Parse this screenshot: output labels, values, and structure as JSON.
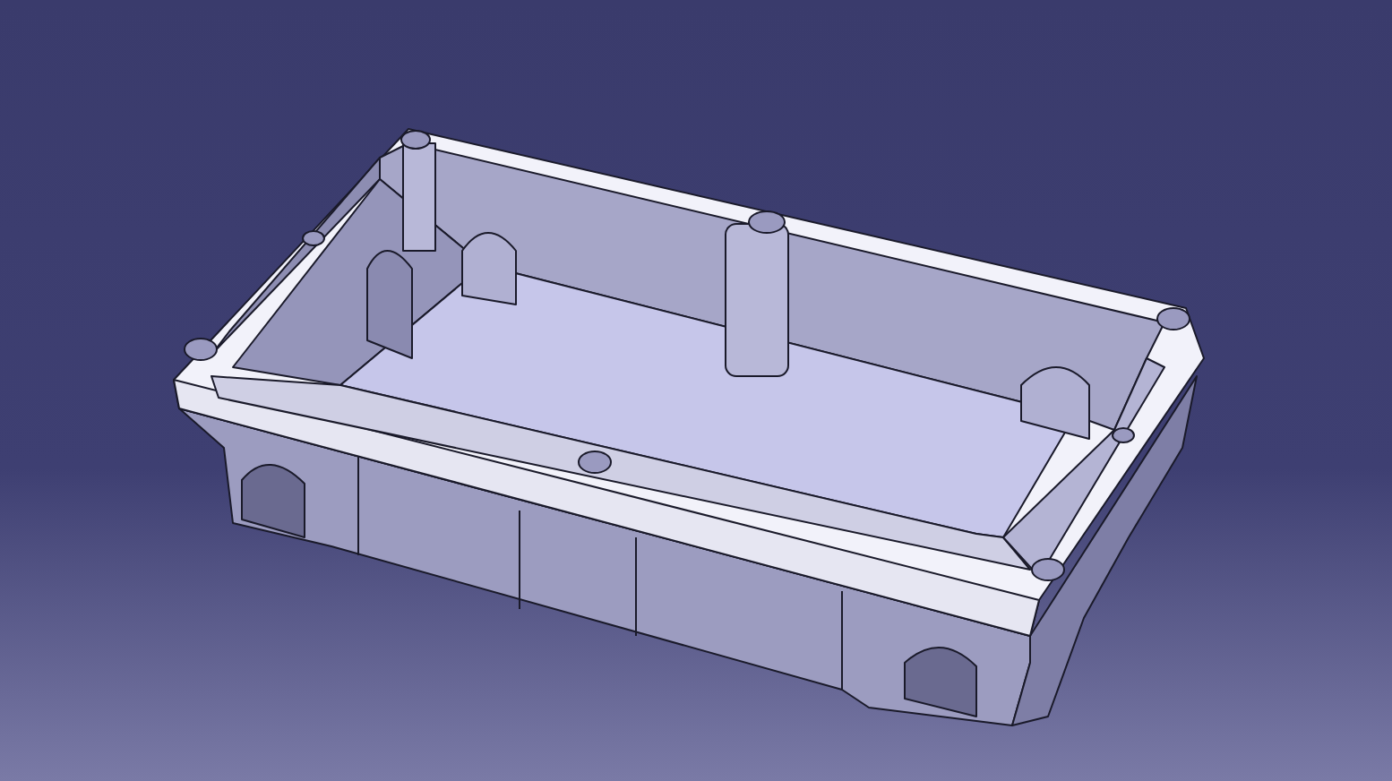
{
  "scene": {
    "kind": "cad-model"
  }
}
